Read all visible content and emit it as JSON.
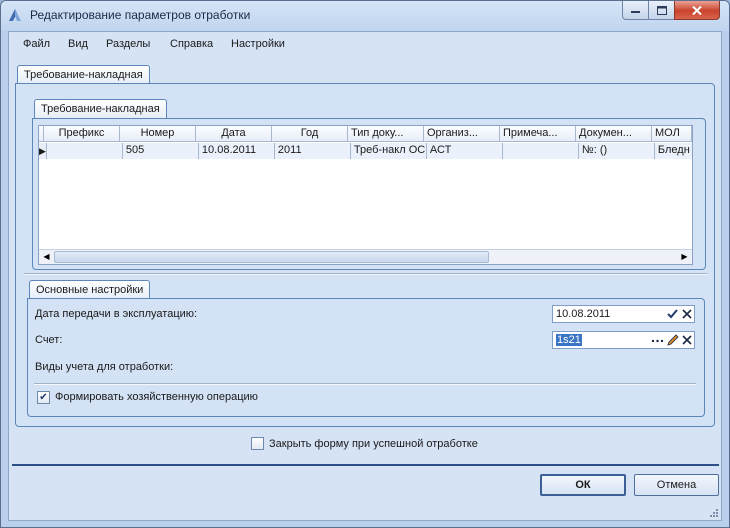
{
  "window": {
    "title": "Редактирование параметров отработки"
  },
  "menu": [
    "Файл",
    "Вид",
    "Разделы",
    "Справка",
    "Настройки"
  ],
  "outer_tab": {
    "label": "Требование-накладная"
  },
  "inner_tab": {
    "label": "Требование-накладная"
  },
  "grid": {
    "columns": [
      "Префикс",
      "Номер",
      "Дата",
      "Год",
      "Тип доку...",
      "Организ...",
      "Примеча...",
      "Докумен...",
      "МОЛ"
    ],
    "rows": [
      {
        "prefix": "",
        "number": "505",
        "date": "10.08.2011",
        "year": "2011",
        "doc_type": "Треб-накл ОС",
        "org": "АСТ",
        "note": "",
        "document": "№: ()",
        "mol": "Бледн"
      }
    ],
    "row_indicator": "▶"
  },
  "settings": {
    "tab_label": "Основные настройки",
    "date_label": "Дата передачи в эксплуатацию:",
    "date_value": "10.08.2011",
    "account_label": "Счет:",
    "account_value": "1s21",
    "accounting_types_label": "Виды учета для отработки:",
    "form_operation_label": "Формировать хозяйственную операцию",
    "form_operation_checked": true
  },
  "close_form": {
    "label": "Закрыть форму при успешной отработке",
    "checked": false
  },
  "buttons": {
    "ok": "ОК",
    "cancel": "Отмена"
  },
  "colors": {
    "accent": "#2b4f86",
    "selection": "#3a74c4"
  }
}
